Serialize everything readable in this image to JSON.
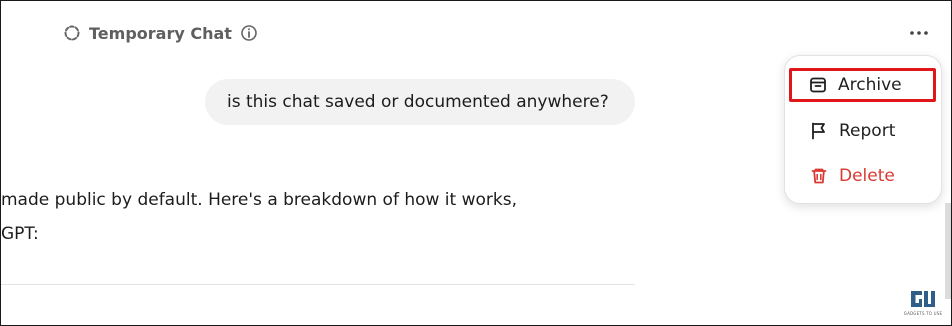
{
  "header": {
    "title": "Temporary Chat",
    "icon": "temporary-chat-icon",
    "info_icon": "info-icon",
    "more_icon": "more-options-icon"
  },
  "conversation": {
    "user_message": "is this chat saved or documented anywhere?",
    "assistant_lines": [
      "made public by default. Here's a breakdown of how it works,",
      "GPT:"
    ]
  },
  "menu": {
    "items": [
      {
        "label": "Archive",
        "icon": "archive-icon"
      },
      {
        "label": "Report",
        "icon": "flag-icon"
      },
      {
        "label": "Delete",
        "icon": "trash-icon"
      }
    ]
  },
  "watermark": {
    "text": "GADGETS TO USE"
  },
  "colors": {
    "highlight_border": "#e0161b",
    "delete_text": "#d93a31",
    "bubble_background": "#f2f2f2",
    "header_text": "#5f5f5f"
  }
}
